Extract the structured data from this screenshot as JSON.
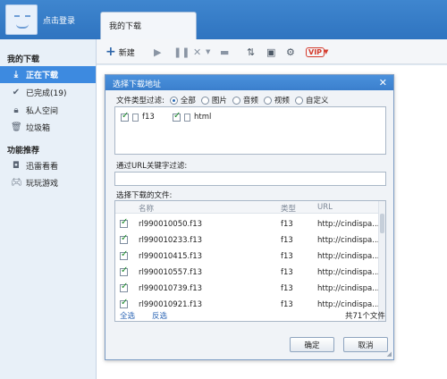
{
  "header": {
    "login_text": "点击登录",
    "tab_label": "我的下载"
  },
  "toolbar": {
    "new_label": "新建",
    "vip_label": "VIP"
  },
  "sidebar": {
    "my_downloads": "我的下载",
    "items": [
      {
        "label": "正在下载"
      },
      {
        "label": "已完成(19)"
      },
      {
        "label": "私人空间"
      },
      {
        "label": "垃圾箱"
      }
    ],
    "recommend": "功能推荐",
    "rec_items": [
      {
        "label": "迅雷看看"
      },
      {
        "label": "玩玩游戏"
      }
    ]
  },
  "dialog": {
    "title": "选择下载地址",
    "filter_label": "文件类型过滤:",
    "radios": [
      "全部",
      "图片",
      "音频",
      "视频",
      "自定义"
    ],
    "selected_radio": "全部",
    "types": [
      "f13",
      "html"
    ],
    "url_filter_label": "通过URL关键字过滤:",
    "url_filter_value": "",
    "files_label": "选择下载的文件:",
    "columns": {
      "name": "名称",
      "type": "类型",
      "url": "URL"
    },
    "files": [
      {
        "name": "rl990010050.f13",
        "type": "f13",
        "url": "http://cindispa..."
      },
      {
        "name": "rl990010233.f13",
        "type": "f13",
        "url": "http://cindispa..."
      },
      {
        "name": "rl990010415.f13",
        "type": "f13",
        "url": "http://cindispa..."
      },
      {
        "name": "rl990010557.f13",
        "type": "f13",
        "url": "http://cindispa..."
      },
      {
        "name": "rl990010739.f13",
        "type": "f13",
        "url": "http://cindispa..."
      },
      {
        "name": "rl990010921.f13",
        "type": "f13",
        "url": "http://cindispa..."
      }
    ],
    "select_all": "全选",
    "invert": "反选",
    "total": "共71个文件",
    "ok": "确定",
    "cancel": "取消"
  }
}
